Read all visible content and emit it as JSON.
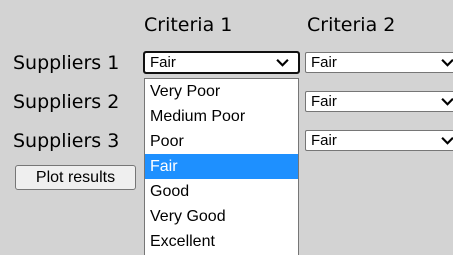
{
  "columns": [
    "Criteria 1",
    "Criteria 2"
  ],
  "rows": [
    {
      "label": "Suppliers 1",
      "criteria1": "Fair",
      "criteria2": "Fair"
    },
    {
      "label": "Suppliers 2",
      "criteria2": "Fair"
    },
    {
      "label": "Suppliers 3",
      "criteria2": "Fair"
    }
  ],
  "plot_button": "Plot results",
  "dropdown": {
    "options": [
      "Very Poor",
      "Medium Poor",
      "Poor",
      "Fair",
      "Good",
      "Very Good",
      "Excellent"
    ],
    "selected": "Fair"
  },
  "colors": {
    "background": "#d3d3d3",
    "option_highlight": "#1e90ff"
  },
  "icons": {
    "select_arrow": "chevron-down-icon"
  }
}
